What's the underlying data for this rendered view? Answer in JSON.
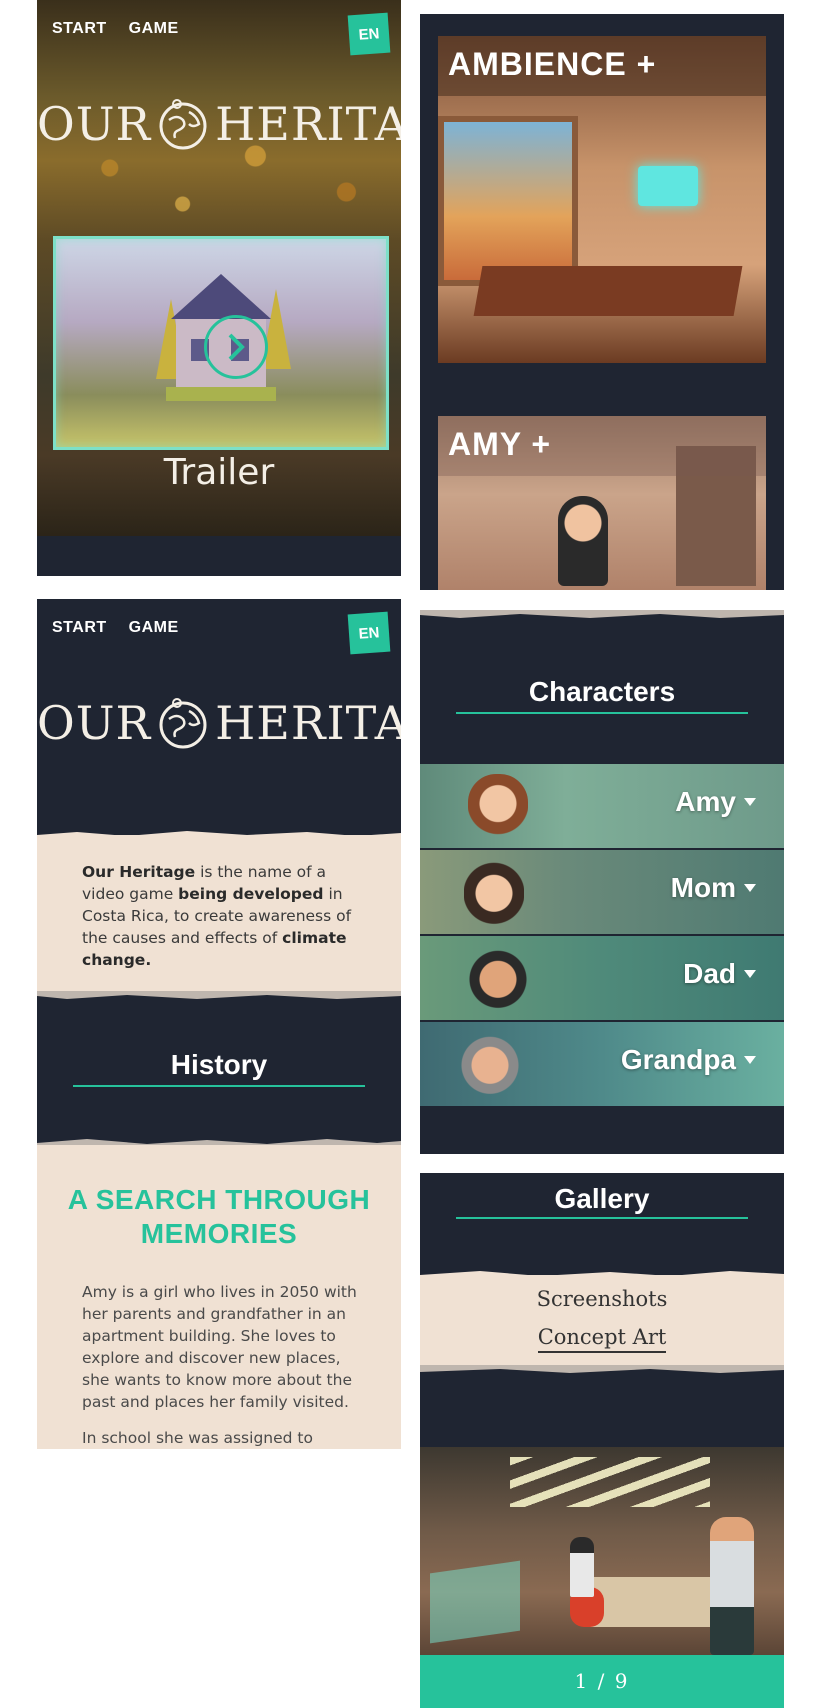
{
  "nav": {
    "start": "START",
    "game": "GAME",
    "lang": "EN"
  },
  "logo": {
    "left": "OUR",
    "right": "HERITAGE"
  },
  "hero": {
    "trailer_label": "Trailer"
  },
  "scenes": {
    "ambience": "AMBIENCE +",
    "amy": "AMY +"
  },
  "about": {
    "p1": "Our Heritage",
    "p2": " is the name of a video game ",
    "p3": "being developed",
    "p4": " in Costa Rica, to create awareness of the causes and effects of ",
    "p5": "climate change."
  },
  "history": {
    "title": "History",
    "story_title_1": "A SEARCH THROUGH",
    "story_title_2": "MEMORIES",
    "story_p1": "Amy is a girl who lives in 2050 with her parents and grandfather in an apartment building. She loves to explore and discover new places, she wants to know more about the past and places her family visited.",
    "story_p2": "In school she was assigned to"
  },
  "characters": {
    "title": "Characters",
    "items": [
      {
        "name": "Amy"
      },
      {
        "name": "Mom"
      },
      {
        "name": "Dad"
      },
      {
        "name": "Grandpa"
      }
    ]
  },
  "gallery": {
    "title": "Gallery",
    "tab_screenshots": "Screenshots",
    "tab_concept": "Concept Art",
    "counter": "1 / 9"
  },
  "colors": {
    "accent": "#26c29b",
    "dark": "#1f2532",
    "paper": "#f0e1d3"
  }
}
